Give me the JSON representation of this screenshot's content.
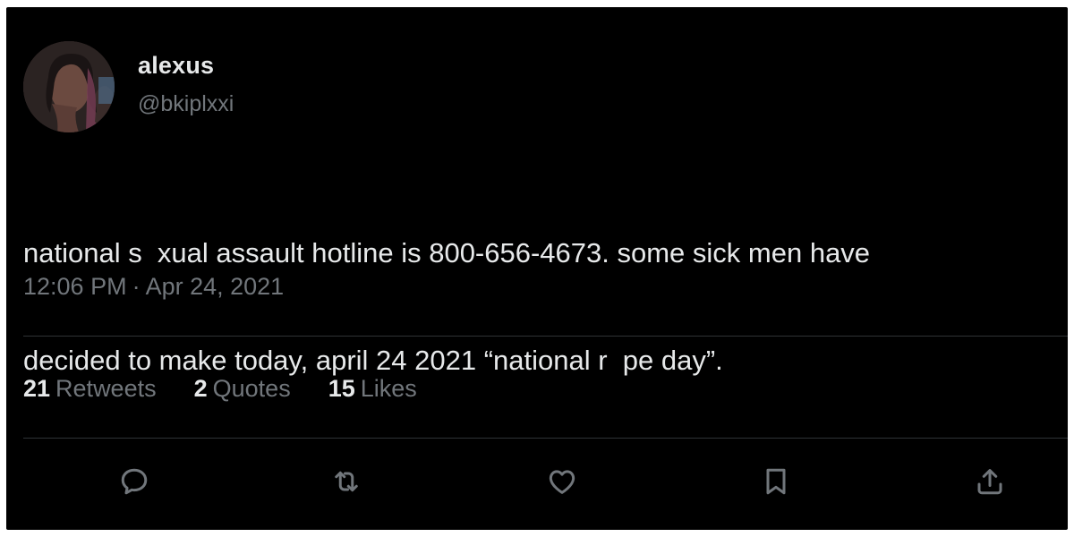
{
  "tweet": {
    "author": {
      "display_name": "alexus",
      "handle": "@bkiplxxi",
      "avatar": "profile-photo"
    },
    "text_lines": [
      "national s  xual assault hotline is 800-656-4673. some sick men have",
      "decided to make today, april 24 2021 “national r  pe day”."
    ],
    "timestamp": {
      "time": "12:06 PM",
      "separator": "·",
      "date": "Apr 24, 2021"
    },
    "stats": {
      "retweets": {
        "count": "21",
        "label": "Retweets"
      },
      "quotes": {
        "count": "2",
        "label": "Quotes"
      },
      "likes": {
        "count": "15",
        "label": "Likes"
      }
    },
    "actions": [
      {
        "name": "reply",
        "icon": "speech-bubble-icon"
      },
      {
        "name": "retweet",
        "icon": "retweet-arrows-icon"
      },
      {
        "name": "like",
        "icon": "heart-icon"
      },
      {
        "name": "bookmark",
        "icon": "bookmark-icon"
      },
      {
        "name": "share",
        "icon": "share-upload-icon"
      }
    ]
  },
  "colors": {
    "background": "#000000",
    "primary_text": "#e7e9ea",
    "secondary_text": "#71767b",
    "divider": "#2f3336"
  }
}
